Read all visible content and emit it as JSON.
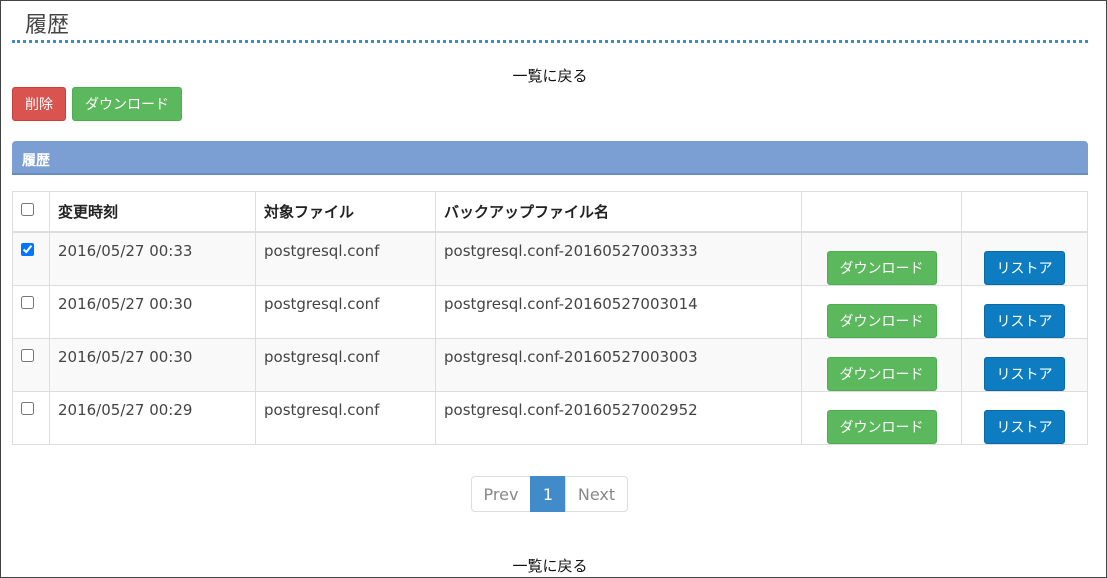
{
  "page": {
    "title": "履歴",
    "back_label": "一覧に戻る"
  },
  "toolbar": {
    "delete_label": "削除",
    "download_label": "ダウンロード"
  },
  "panel": {
    "title": "履歴"
  },
  "table": {
    "headers": [
      "変更時刻",
      "対象ファイル",
      "バックアップファイル名"
    ],
    "rows": [
      {
        "checked": true,
        "time": "2016/05/27 00:33",
        "file": "postgresql.conf",
        "backup": "postgresql.conf-20160527003333",
        "download_label": "ダウンロード",
        "restore_label": "リストア"
      },
      {
        "checked": false,
        "time": "2016/05/27 00:30",
        "file": "postgresql.conf",
        "backup": "postgresql.conf-20160527003014",
        "download_label": "ダウンロード",
        "restore_label": "リストア"
      },
      {
        "checked": false,
        "time": "2016/05/27 00:30",
        "file": "postgresql.conf",
        "backup": "postgresql.conf-20160527003003",
        "download_label": "ダウンロード",
        "restore_label": "リストア"
      },
      {
        "checked": false,
        "time": "2016/05/27 00:29",
        "file": "postgresql.conf",
        "backup": "postgresql.conf-20160527002952",
        "download_label": "ダウンロード",
        "restore_label": "リストア"
      }
    ]
  },
  "pagination": {
    "prev": "Prev",
    "current": "1",
    "next": "Next"
  },
  "colors": {
    "danger": "#d9534f",
    "success": "#5cb85c",
    "primary": "#0d7cc1",
    "panel": "#7b9fd3"
  }
}
